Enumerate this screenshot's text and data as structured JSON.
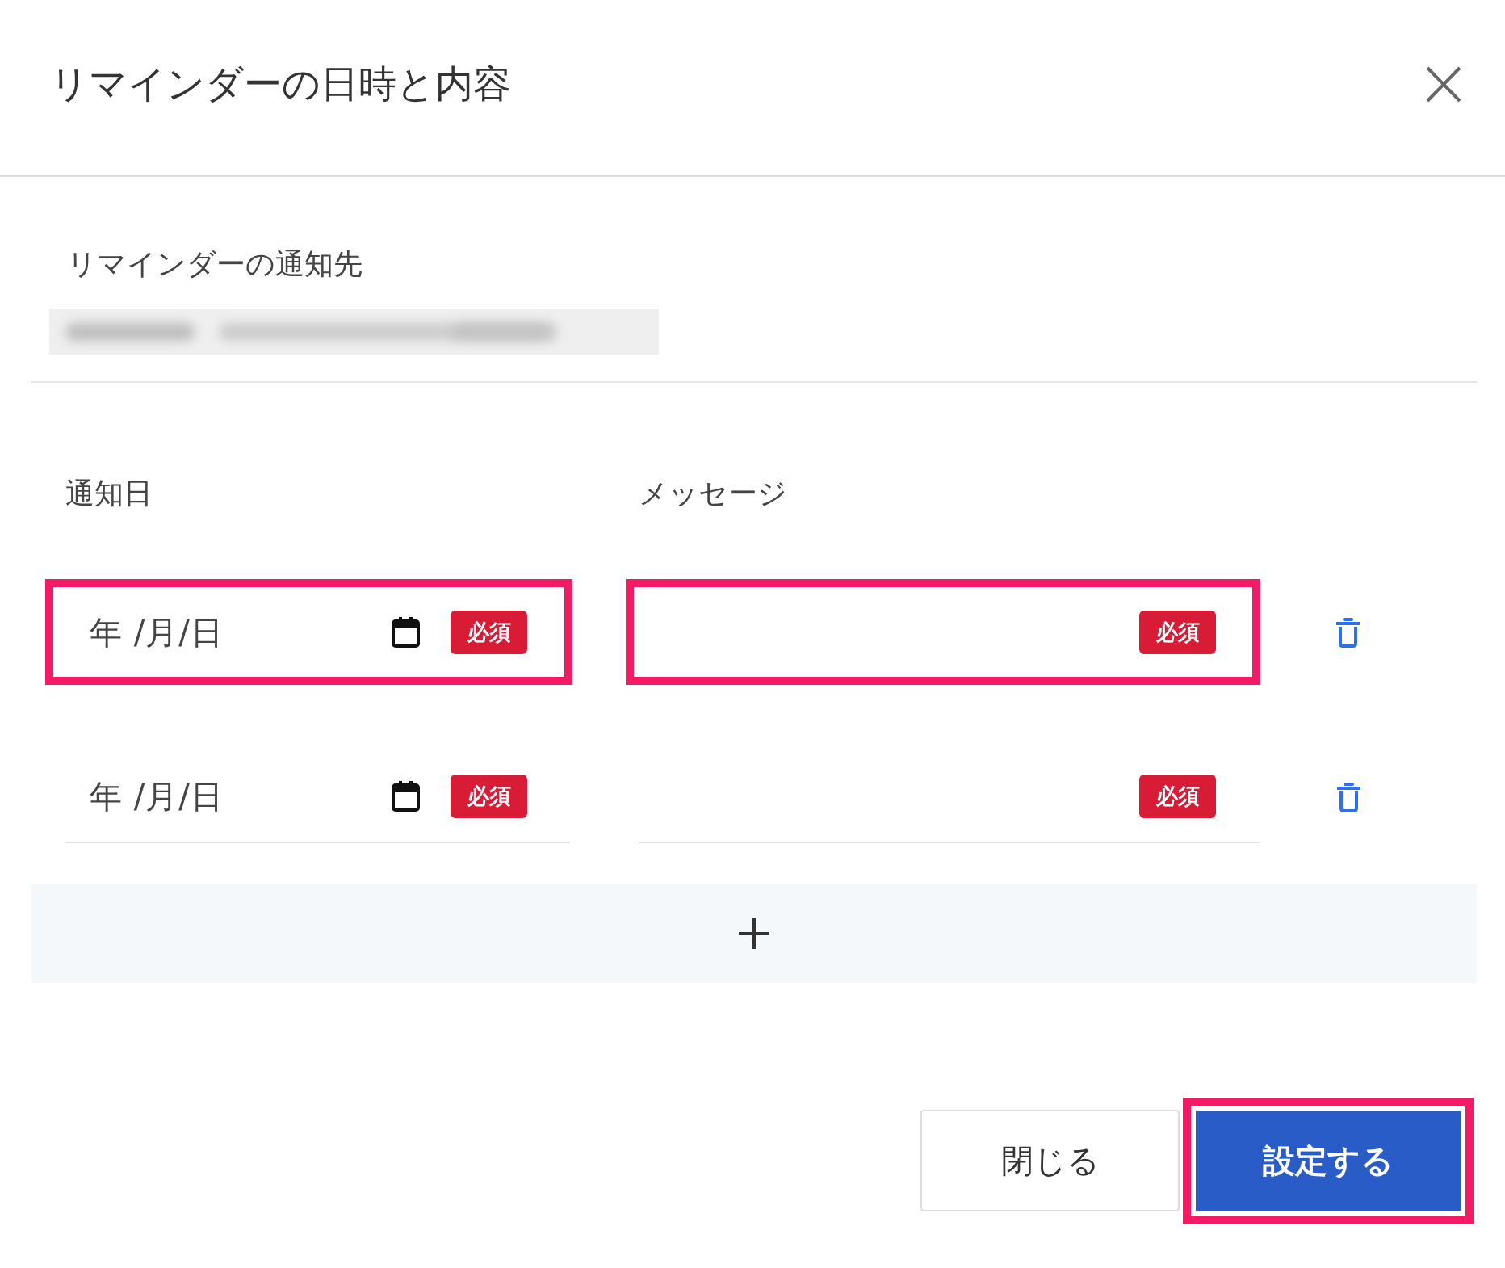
{
  "dialog": {
    "title": "リマインダーの日時と内容"
  },
  "recipient": {
    "label": "リマインダーの通知先"
  },
  "columns": [
    "通知日",
    "メッセージ"
  ],
  "rows": [
    {
      "date": {
        "placeholder": "年 /月/日",
        "badge": "必須",
        "highlighted": true
      },
      "message": {
        "badge": "必須",
        "highlighted": true
      }
    },
    {
      "date": {
        "placeholder": "年 /月/日",
        "badge": "必須",
        "highlighted": false
      },
      "message": {
        "badge": "必須",
        "highlighted": false
      }
    }
  ],
  "buttons": [
    {
      "label": "閉じる",
      "kind": "secondary",
      "highlighted": false
    },
    {
      "label": "設定する",
      "kind": "primary",
      "highlighted": true
    }
  ]
}
